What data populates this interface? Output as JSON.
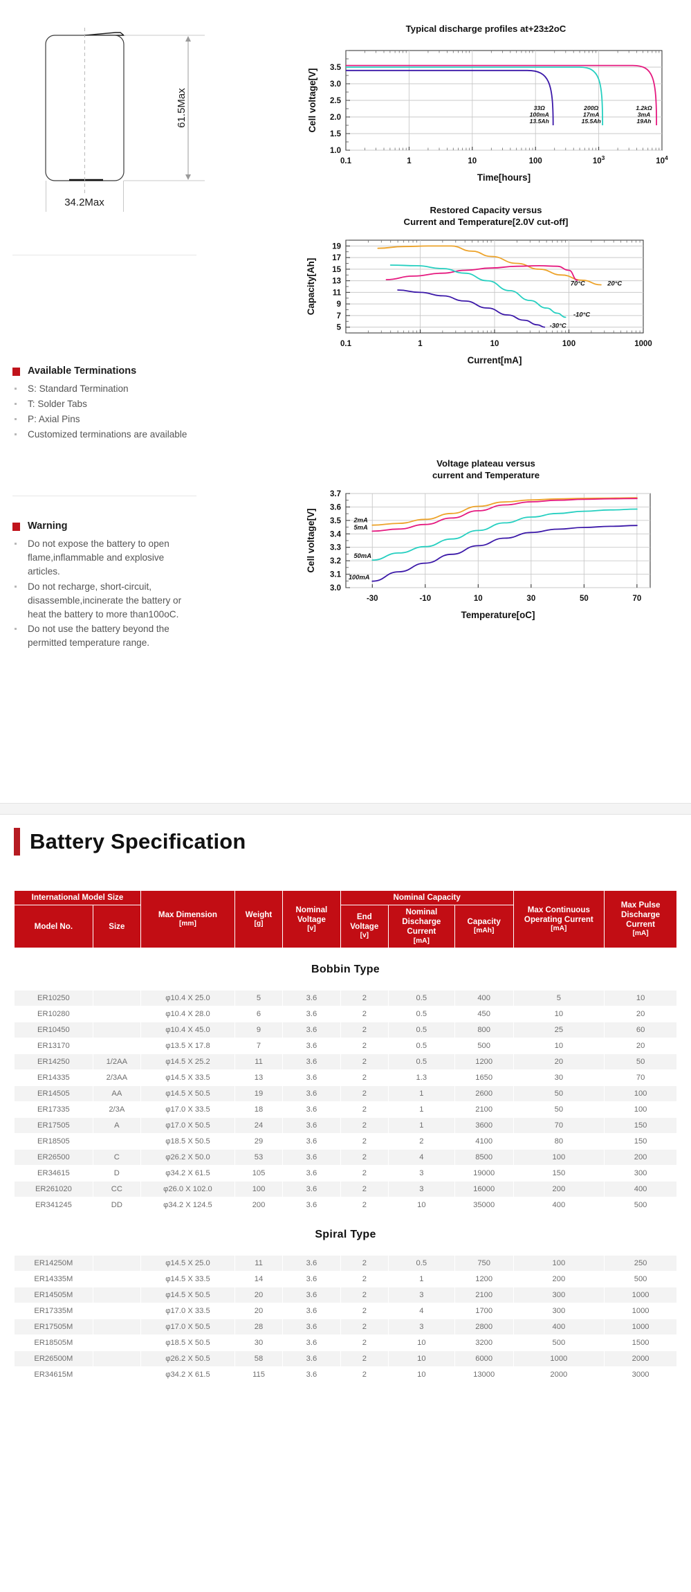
{
  "drawing": {
    "height_label": "61.5Max",
    "width_label": "34.2Max"
  },
  "terminations": {
    "title": "Available Terminations",
    "items": [
      "S: Standard Termination",
      "T: Solder Tabs",
      "P: Axial Pins",
      "Customized terminations are available"
    ]
  },
  "warning": {
    "title": "Warning",
    "items": [
      "Do not expose the battery to open flame,inflammable and explosive articles.",
      "Do not recharge, short-circuit, disassemble,incinerate the battery or heat the battery to more than100oC.",
      "Do not use the battery beyond the permitted temperature range."
    ]
  },
  "chart_data": [
    {
      "type": "line",
      "title": "Typical discharge profiles at+23±2oC",
      "xlabel": "Time[hours]",
      "ylabel": "Cell voltage[V]",
      "xscale": "log",
      "xlim": [
        0.1,
        10000
      ],
      "ylim": [
        1.0,
        4.0
      ],
      "xticks": [
        "0.1",
        "1",
        "10",
        "100",
        "10³",
        "10⁴"
      ],
      "xtick_values": [
        0.1,
        1,
        10,
        100,
        1000,
        10000
      ],
      "yticks": [
        "1.0",
        "1.5",
        "2.0",
        "2.5",
        "3.0",
        "3.5"
      ],
      "ytick_values": [
        1.0,
        1.5,
        2.0,
        2.5,
        3.0,
        3.5
      ],
      "grid": true,
      "annotations": [
        {
          "lines": [
            "33Ω",
            "100mA",
            "13.5Ah"
          ],
          "color": "#3b18a8"
        },
        {
          "lines": [
            "200Ω",
            "17mA",
            "15.5Ah"
          ],
          "color": "#25cfc0"
        },
        {
          "lines": [
            "1.2kΩ",
            "3mA",
            "19Ah"
          ],
          "color": "#e5197f"
        }
      ],
      "series": [
        {
          "name": "33Ω 100mA 13.5Ah",
          "color": "#3b18a8",
          "plateau": 3.4,
          "knee_x": 135,
          "end_x": 190
        },
        {
          "name": "200Ω 17mA 15.5Ah",
          "color": "#25cfc0",
          "plateau": 3.5,
          "knee_x": 900,
          "end_x": 1150
        },
        {
          "name": "1.2kΩ 3mA 19Ah",
          "color": "#e5197f",
          "plateau": 3.55,
          "knee_x": 6300,
          "end_x": 8200
        }
      ]
    },
    {
      "type": "line",
      "title_lines": [
        "Restored Capacity versus",
        "Current and Temperature[2.0V cut-off]"
      ],
      "xlabel": "Current[mA]",
      "ylabel": "Capacity[Ah]",
      "xscale": "log",
      "xlim": [
        0.1,
        1000
      ],
      "ylim": [
        4,
        20
      ],
      "xticks": [
        "0.1",
        "1",
        "10",
        "100",
        "1000"
      ],
      "xtick_values": [
        0.1,
        1,
        10,
        100,
        1000
      ],
      "yticks": [
        "5",
        "7",
        "9",
        "11",
        "13",
        "15",
        "17",
        "19"
      ],
      "ytick_values": [
        5,
        7,
        9,
        11,
        13,
        15,
        17,
        19
      ],
      "grid": true,
      "series": [
        {
          "name": "20°C",
          "color": "#eda32a",
          "label": "20°C",
          "points": [
            [
              0.27,
              18.6
            ],
            [
              0.6,
              18.9
            ],
            [
              1.3,
              19.0
            ],
            [
              2.6,
              19.0
            ],
            [
              5,
              18.1
            ],
            [
              9,
              17.2
            ],
            [
              20,
              16.0
            ],
            [
              40,
              15.0
            ],
            [
              80,
              14.0
            ],
            [
              150,
              13.1
            ],
            [
              270,
              12.3
            ]
          ]
        },
        {
          "name": "70°C",
          "color": "#e5197f",
          "label": "70°C",
          "points": [
            [
              0.35,
              13.2
            ],
            [
              0.8,
              13.8
            ],
            [
              2,
              14.3
            ],
            [
              4,
              14.8
            ],
            [
              9,
              15.2
            ],
            [
              20,
              15.5
            ],
            [
              40,
              15.6
            ],
            [
              70,
              15.5
            ],
            [
              100,
              14.8
            ],
            [
              130,
              13.1
            ]
          ]
        },
        {
          "name": "-10°C",
          "color": "#25cfc0",
          "label": "-10°C",
          "points": [
            [
              0.4,
              15.7
            ],
            [
              0.9,
              15.6
            ],
            [
              2,
              15.1
            ],
            [
              4,
              14.3
            ],
            [
              8,
              13.0
            ],
            [
              16,
              11.3
            ],
            [
              30,
              9.6
            ],
            [
              50,
              8.3
            ],
            [
              70,
              7.4
            ],
            [
              90,
              6.7
            ]
          ]
        },
        {
          "name": "-30°C",
          "color": "#3b18a8",
          "label": "-30°C",
          "points": [
            [
              0.5,
              11.4
            ],
            [
              1,
              11.0
            ],
            [
              2,
              10.4
            ],
            [
              4,
              9.5
            ],
            [
              8,
              8.3
            ],
            [
              15,
              7.1
            ],
            [
              25,
              6.2
            ],
            [
              38,
              5.4
            ],
            [
              47,
              5.0
            ]
          ]
        }
      ]
    },
    {
      "type": "line",
      "title_lines": [
        "Voltage plateau versus",
        "current and Temperature"
      ],
      "xlabel": "Temperature[oC]",
      "ylabel": "Cell voltage[V]",
      "xscale": "linear",
      "xlim": [
        -40,
        75
      ],
      "ylim": [
        3.0,
        3.7
      ],
      "xticks": [
        "-30",
        "-10",
        "10",
        "30",
        "50",
        "70"
      ],
      "xtick_values": [
        -30,
        -10,
        10,
        30,
        50,
        70
      ],
      "yticks": [
        "3.0",
        "3.1",
        "3.2",
        "3.3",
        "3.4",
        "3.5",
        "3.6",
        "3.7"
      ],
      "ytick_values": [
        3.0,
        3.1,
        3.2,
        3.3,
        3.4,
        3.5,
        3.6,
        3.7
      ],
      "grid": true,
      "series": [
        {
          "name": "2mA",
          "color": "#eda32a",
          "label": "2mA",
          "points": [
            [
              -30,
              3.465
            ],
            [
              -20,
              3.478
            ],
            [
              -10,
              3.508
            ],
            [
              0,
              3.552
            ],
            [
              10,
              3.605
            ],
            [
              20,
              3.637
            ],
            [
              30,
              3.652
            ],
            [
              40,
              3.66
            ],
            [
              50,
              3.664
            ],
            [
              60,
              3.666
            ],
            [
              70,
              3.668
            ]
          ]
        },
        {
          "name": "5mA",
          "color": "#e5197f",
          "label": "5mA",
          "points": [
            [
              -30,
              3.42
            ],
            [
              -20,
              3.436
            ],
            [
              -10,
              3.47
            ],
            [
              0,
              3.518
            ],
            [
              10,
              3.572
            ],
            [
              20,
              3.615
            ],
            [
              30,
              3.638
            ],
            [
              40,
              3.65
            ],
            [
              50,
              3.657
            ],
            [
              60,
              3.661
            ],
            [
              70,
              3.663
            ]
          ]
        },
        {
          "name": "50mA",
          "color": "#25cfc0",
          "label": "50mA",
          "points": [
            [
              -30,
              3.205
            ],
            [
              -20,
              3.258
            ],
            [
              -10,
              3.305
            ],
            [
              0,
              3.362
            ],
            [
              10,
              3.425
            ],
            [
              20,
              3.482
            ],
            [
              30,
              3.525
            ],
            [
              40,
              3.552
            ],
            [
              50,
              3.568
            ],
            [
              60,
              3.578
            ],
            [
              70,
              3.584
            ]
          ]
        },
        {
          "name": "100mA",
          "color": "#3b18a8",
          "label": "100mA",
          "points": [
            [
              -30,
              3.048
            ],
            [
              -20,
              3.118
            ],
            [
              -10,
              3.182
            ],
            [
              0,
              3.248
            ],
            [
              10,
              3.312
            ],
            [
              20,
              3.368
            ],
            [
              30,
              3.41
            ],
            [
              40,
              3.435
            ],
            [
              50,
              3.448
            ],
            [
              60,
              3.456
            ],
            [
              70,
              3.462
            ]
          ]
        }
      ]
    }
  ],
  "section": {
    "heading": "Battery Specification"
  },
  "table": {
    "header": {
      "group_international": "International Model Size",
      "model_no": "Model No.",
      "size": "Size",
      "max_dimension": "Max Dimension",
      "max_dimension_unit": "[mm]",
      "weight": "Weight",
      "weight_unit": "[g]",
      "nominal_voltage": "Nominal Voltage",
      "nominal_voltage_unit": "[v]",
      "nominal_capacity": "Nominal Capacity",
      "end_voltage": "End Voltage",
      "end_voltage_unit": "[v]",
      "nominal_discharge_current": "Nominal Discharge Current",
      "nominal_discharge_current_unit": "[mA]",
      "capacity": "Capacity",
      "capacity_unit": "[mAh]",
      "max_continuous": "Max Continuous Operating Current",
      "max_continuous_unit": "[mA]",
      "max_pulse": "Max Pulse Discharge Current",
      "max_pulse_unit": "[mA]"
    },
    "groups": [
      {
        "name": "Bobbin Type",
        "rows": [
          [
            "ER10250",
            "",
            "φ10.4 X 25.0",
            "5",
            "3.6",
            "2",
            "0.5",
            "400",
            "5",
            "10"
          ],
          [
            "ER10280",
            "",
            "φ10.4 X 28.0",
            "6",
            "3.6",
            "2",
            "0.5",
            "450",
            "10",
            "20"
          ],
          [
            "ER10450",
            "",
            "φ10.4 X 45.0",
            "9",
            "3.6",
            "2",
            "0.5",
            "800",
            "25",
            "60"
          ],
          [
            "ER13170",
            "",
            "φ13.5 X 17.8",
            "7",
            "3.6",
            "2",
            "0.5",
            "500",
            "10",
            "20"
          ],
          [
            "ER14250",
            "1/2AA",
            "φ14.5 X 25.2",
            "11",
            "3.6",
            "2",
            "0.5",
            "1200",
            "20",
            "50"
          ],
          [
            "ER14335",
            "2/3AA",
            "φ14.5 X 33.5",
            "13",
            "3.6",
            "2",
            "1.3",
            "1650",
            "30",
            "70"
          ],
          [
            "ER14505",
            "AA",
            "φ14.5 X 50.5",
            "19",
            "3.6",
            "2",
            "1",
            "2600",
            "50",
            "100"
          ],
          [
            "ER17335",
            "2/3A",
            "φ17.0 X 33.5",
            "18",
            "3.6",
            "2",
            "1",
            "2100",
            "50",
            "100"
          ],
          [
            "ER17505",
            "A",
            "φ17.0 X 50.5",
            "24",
            "3.6",
            "2",
            "1",
            "3600",
            "70",
            "150"
          ],
          [
            "ER18505",
            "",
            "φ18.5 X 50.5",
            "29",
            "3.6",
            "2",
            "2",
            "4100",
            "80",
            "150"
          ],
          [
            "ER26500",
            "C",
            "φ26.2 X 50.0",
            "53",
            "3.6",
            "2",
            "4",
            "8500",
            "100",
            "200"
          ],
          [
            "ER34615",
            "D",
            "φ34.2 X 61.5",
            "105",
            "3.6",
            "2",
            "3",
            "19000",
            "150",
            "300"
          ],
          [
            "ER261020",
            "CC",
            "φ26.0 X 102.0",
            "100",
            "3.6",
            "2",
            "3",
            "16000",
            "200",
            "400"
          ],
          [
            "ER341245",
            "DD",
            "φ34.2 X 124.5",
            "200",
            "3.6",
            "2",
            "10",
            "35000",
            "400",
            "500"
          ]
        ]
      },
      {
        "name": "Spiral Type",
        "rows": [
          [
            "ER14250M",
            "",
            "φ14.5 X 25.0",
            "11",
            "3.6",
            "2",
            "0.5",
            "750",
            "100",
            "250"
          ],
          [
            "ER14335M",
            "",
            "φ14.5 X 33.5",
            "14",
            "3.6",
            "2",
            "1",
            "1200",
            "200",
            "500"
          ],
          [
            "ER14505M",
            "",
            "φ14.5 X 50.5",
            "20",
            "3.6",
            "2",
            "3",
            "2100",
            "300",
            "1000"
          ],
          [
            "ER17335M",
            "",
            "φ17.0 X 33.5",
            "20",
            "3.6",
            "2",
            "4",
            "1700",
            "300",
            "1000"
          ],
          [
            "ER17505M",
            "",
            "φ17.0 X 50.5",
            "28",
            "3.6",
            "2",
            "3",
            "2800",
            "400",
            "1000"
          ],
          [
            "ER18505M",
            "",
            "φ18.5 X 50.5",
            "30",
            "3.6",
            "2",
            "10",
            "3200",
            "500",
            "1500"
          ],
          [
            "ER26500M",
            "",
            "φ26.2 X 50.5",
            "58",
            "3.6",
            "2",
            "10",
            "6000",
            "1000",
            "2000"
          ],
          [
            "ER34615M",
            "",
            "φ34.2 X 61.5",
            "115",
            "3.6",
            "2",
            "10",
            "13000",
            "2000",
            "3000"
          ]
        ]
      }
    ]
  },
  "colors": {
    "brand_red": "#c20d14",
    "heading_red": "#b51b22",
    "series_purple": "#3b18a8",
    "series_cyan": "#25cfc0",
    "series_pink": "#e5197f",
    "series_orange": "#eda32a"
  }
}
